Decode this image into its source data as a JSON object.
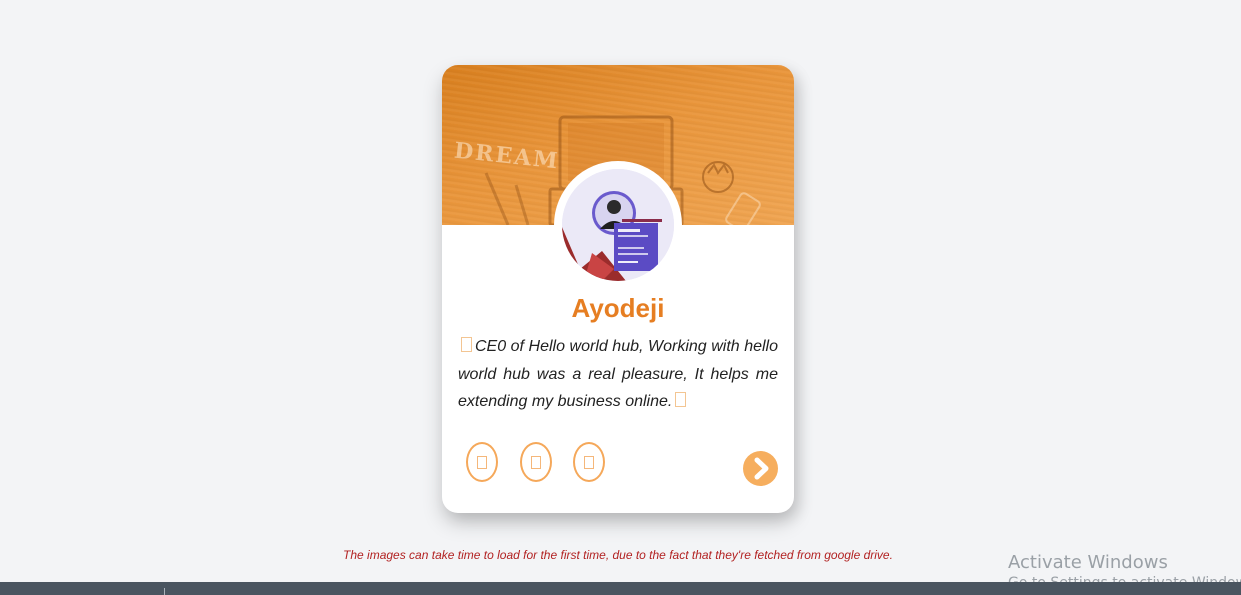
{
  "card": {
    "name": "Ayodeji",
    "quote": "CE0 of Hello world hub, Working with hello world hub was a real pleasure, It helps me extending my business online.",
    "banner_word": "DREAM",
    "next_icon": "chevron-right-icon",
    "social_icons": [
      "social-icon-1",
      "social-icon-2",
      "social-icon-3"
    ],
    "accent_color": "#e67e22"
  },
  "note": "The images can take time to load for the first time, due to the fact that they're fetched from google drive.",
  "watermark": {
    "line1": "Activate Windows",
    "line2": "Go to Settings to activate Windows."
  }
}
